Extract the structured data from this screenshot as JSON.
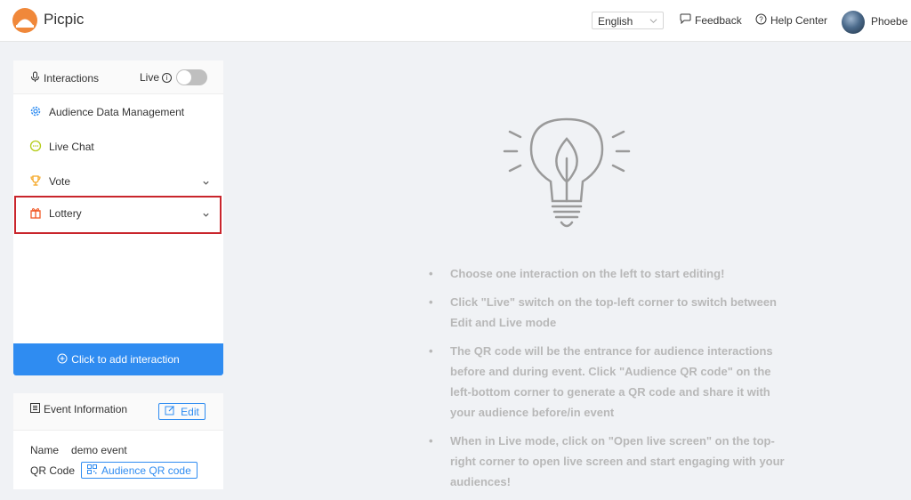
{
  "header": {
    "app_name": "Picpic",
    "language": "English",
    "feedback_label": "Feedback",
    "help_label": "Help Center",
    "user_name": "Phoebe"
  },
  "interactions": {
    "title": "Interactions",
    "live_label": "Live",
    "live_enabled": false,
    "items": [
      {
        "label": "Audience Data Management",
        "icon": "gear-icon",
        "color": "#2f8cf1"
      },
      {
        "label": "Live Chat",
        "icon": "chat-icon",
        "color": "#b5cc18"
      },
      {
        "label": "Vote",
        "icon": "trophy-icon",
        "color": "#f5a623"
      },
      {
        "label": "Lottery",
        "icon": "gift-icon",
        "color": "#f05a28"
      }
    ],
    "add_button_label": "Click to add interaction"
  },
  "event_info": {
    "title": "Event Information",
    "edit_label": "Edit",
    "name_key": "Name",
    "name_value": "demo event",
    "qr_key": "QR Code",
    "qr_button_label": "Audience QR code"
  },
  "tips": [
    "Choose one interaction on the left to start editing!",
    "Click \"Live\" switch on the top-left corner to switch between Edit and Live mode",
    "The QR code will be the entrance for audience interactions before and during event. Click \"Audience QR code\" on the left-bottom corner to generate a QR code and share it with your audience before/in event",
    "When in Live mode, click on \"Open live screen\" on the top-right corner to open live screen and start engaging with your audiences!"
  ],
  "colors": {
    "accent": "#2f8cf1",
    "highlight": "#c9252c",
    "brand": "#f0883a"
  }
}
